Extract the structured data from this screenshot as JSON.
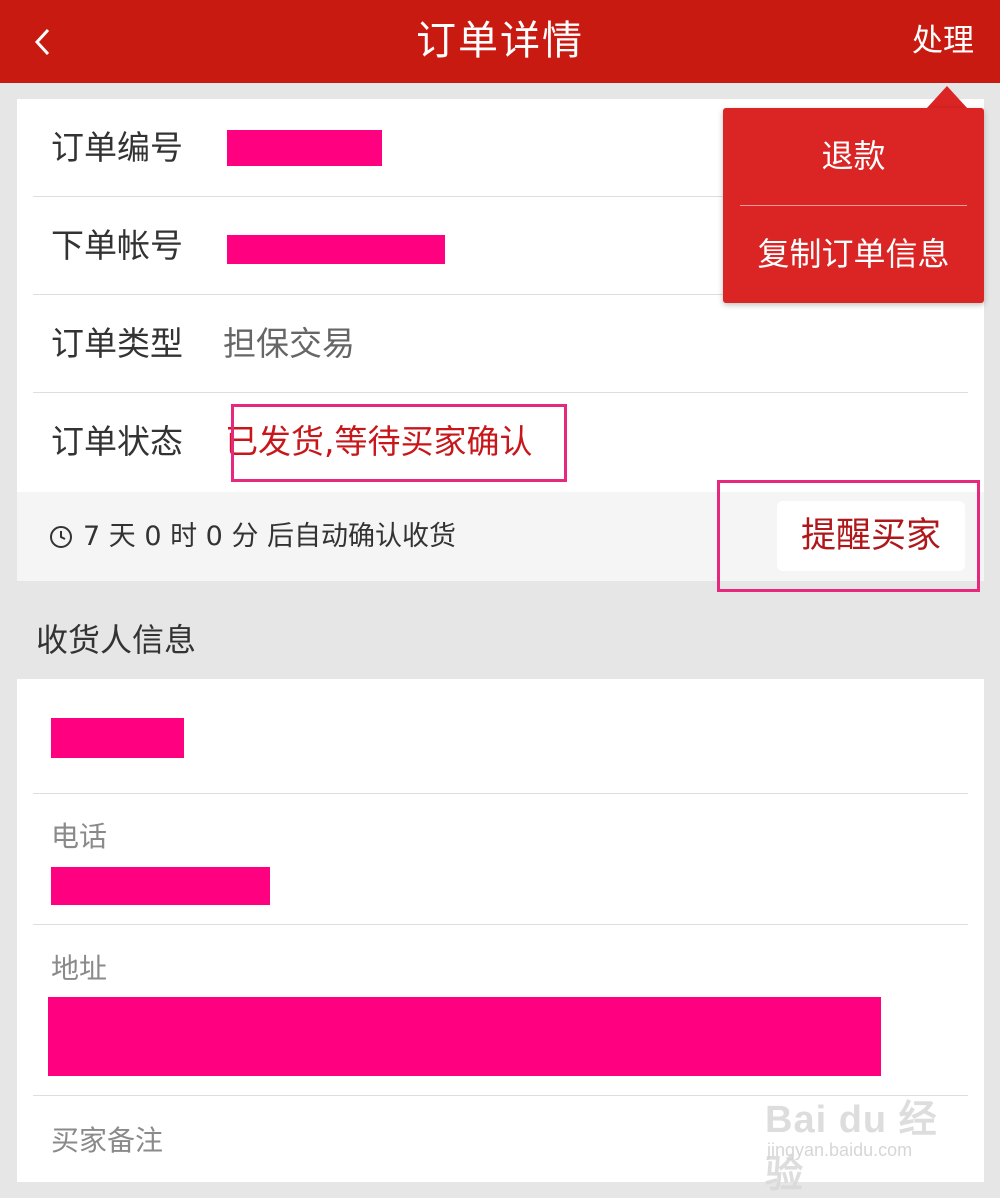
{
  "header": {
    "title": "订单详情",
    "action_label": "处理"
  },
  "order": {
    "rows": [
      {
        "label": "订单编号"
      },
      {
        "label": "下单帐号"
      },
      {
        "label": "订单类型",
        "value": "担保交易"
      },
      {
        "label": "订单状态",
        "value": "已发货,等待买家确认"
      }
    ],
    "countdown_text": "7 天 0 时 0 分 后自动确认收货",
    "remind_button_label": "提醒买家"
  },
  "consignee": {
    "section_title": "收货人信息",
    "phone_label": "电话",
    "address_label": "地址",
    "remark_label": "买家备注"
  },
  "popup_menu": {
    "items": [
      "退款",
      "复制订单信息"
    ]
  },
  "watermark": {
    "brand": "Bai du 经验",
    "url": "jingyan.baidu.com"
  },
  "colors": {
    "header_bg": "#c81a10",
    "status_text": "#c8171b",
    "popup_bg": "#db2424",
    "redaction": "#ff0080",
    "highlight_border": "#e6287e"
  },
  "icons": {
    "back": "chevron-left-icon",
    "clock": "clock-icon",
    "popup_arrow": "caret-up-icon"
  }
}
